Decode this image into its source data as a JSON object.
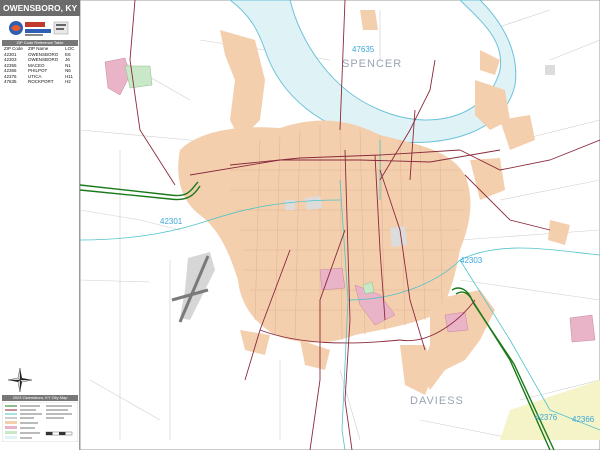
{
  "title": "OWENSBORO, KY",
  "zip_table": {
    "header": "ZIP Code Reference Table",
    "columns": [
      "ZIP Code",
      "ZIP Name",
      "LOC"
    ],
    "rows": [
      [
        "42301",
        "OWENSBORO",
        "E6"
      ],
      [
        "42303",
        "OWENSBORO",
        "J6"
      ],
      [
        "42355",
        "MACEO",
        "N1"
      ],
      [
        "42366",
        "PHILPOT",
        "N6"
      ],
      [
        "42376",
        "UTICA",
        "H11"
      ],
      [
        "47635",
        "ROCKPORT",
        "H2"
      ]
    ]
  },
  "legend_title": "2023 Owensboro, KY City Map",
  "map_labels": {
    "zips": [
      "47635",
      "42301",
      "42303",
      "42376",
      "42366"
    ],
    "counties": [
      "SPENCER",
      "DAVIESS"
    ]
  },
  "colors": {
    "river": "#dff2f6",
    "river_edge": "#6ec3d8",
    "urban": "#f4cfae",
    "highway": "#1a7a1a",
    "major_road": "#8a2a3a",
    "zip_boundary": "#4fc3c8",
    "title_bg": "#6b6b6b"
  },
  "icons": [
    "compass-rose-icon",
    "publisher-logo"
  ]
}
